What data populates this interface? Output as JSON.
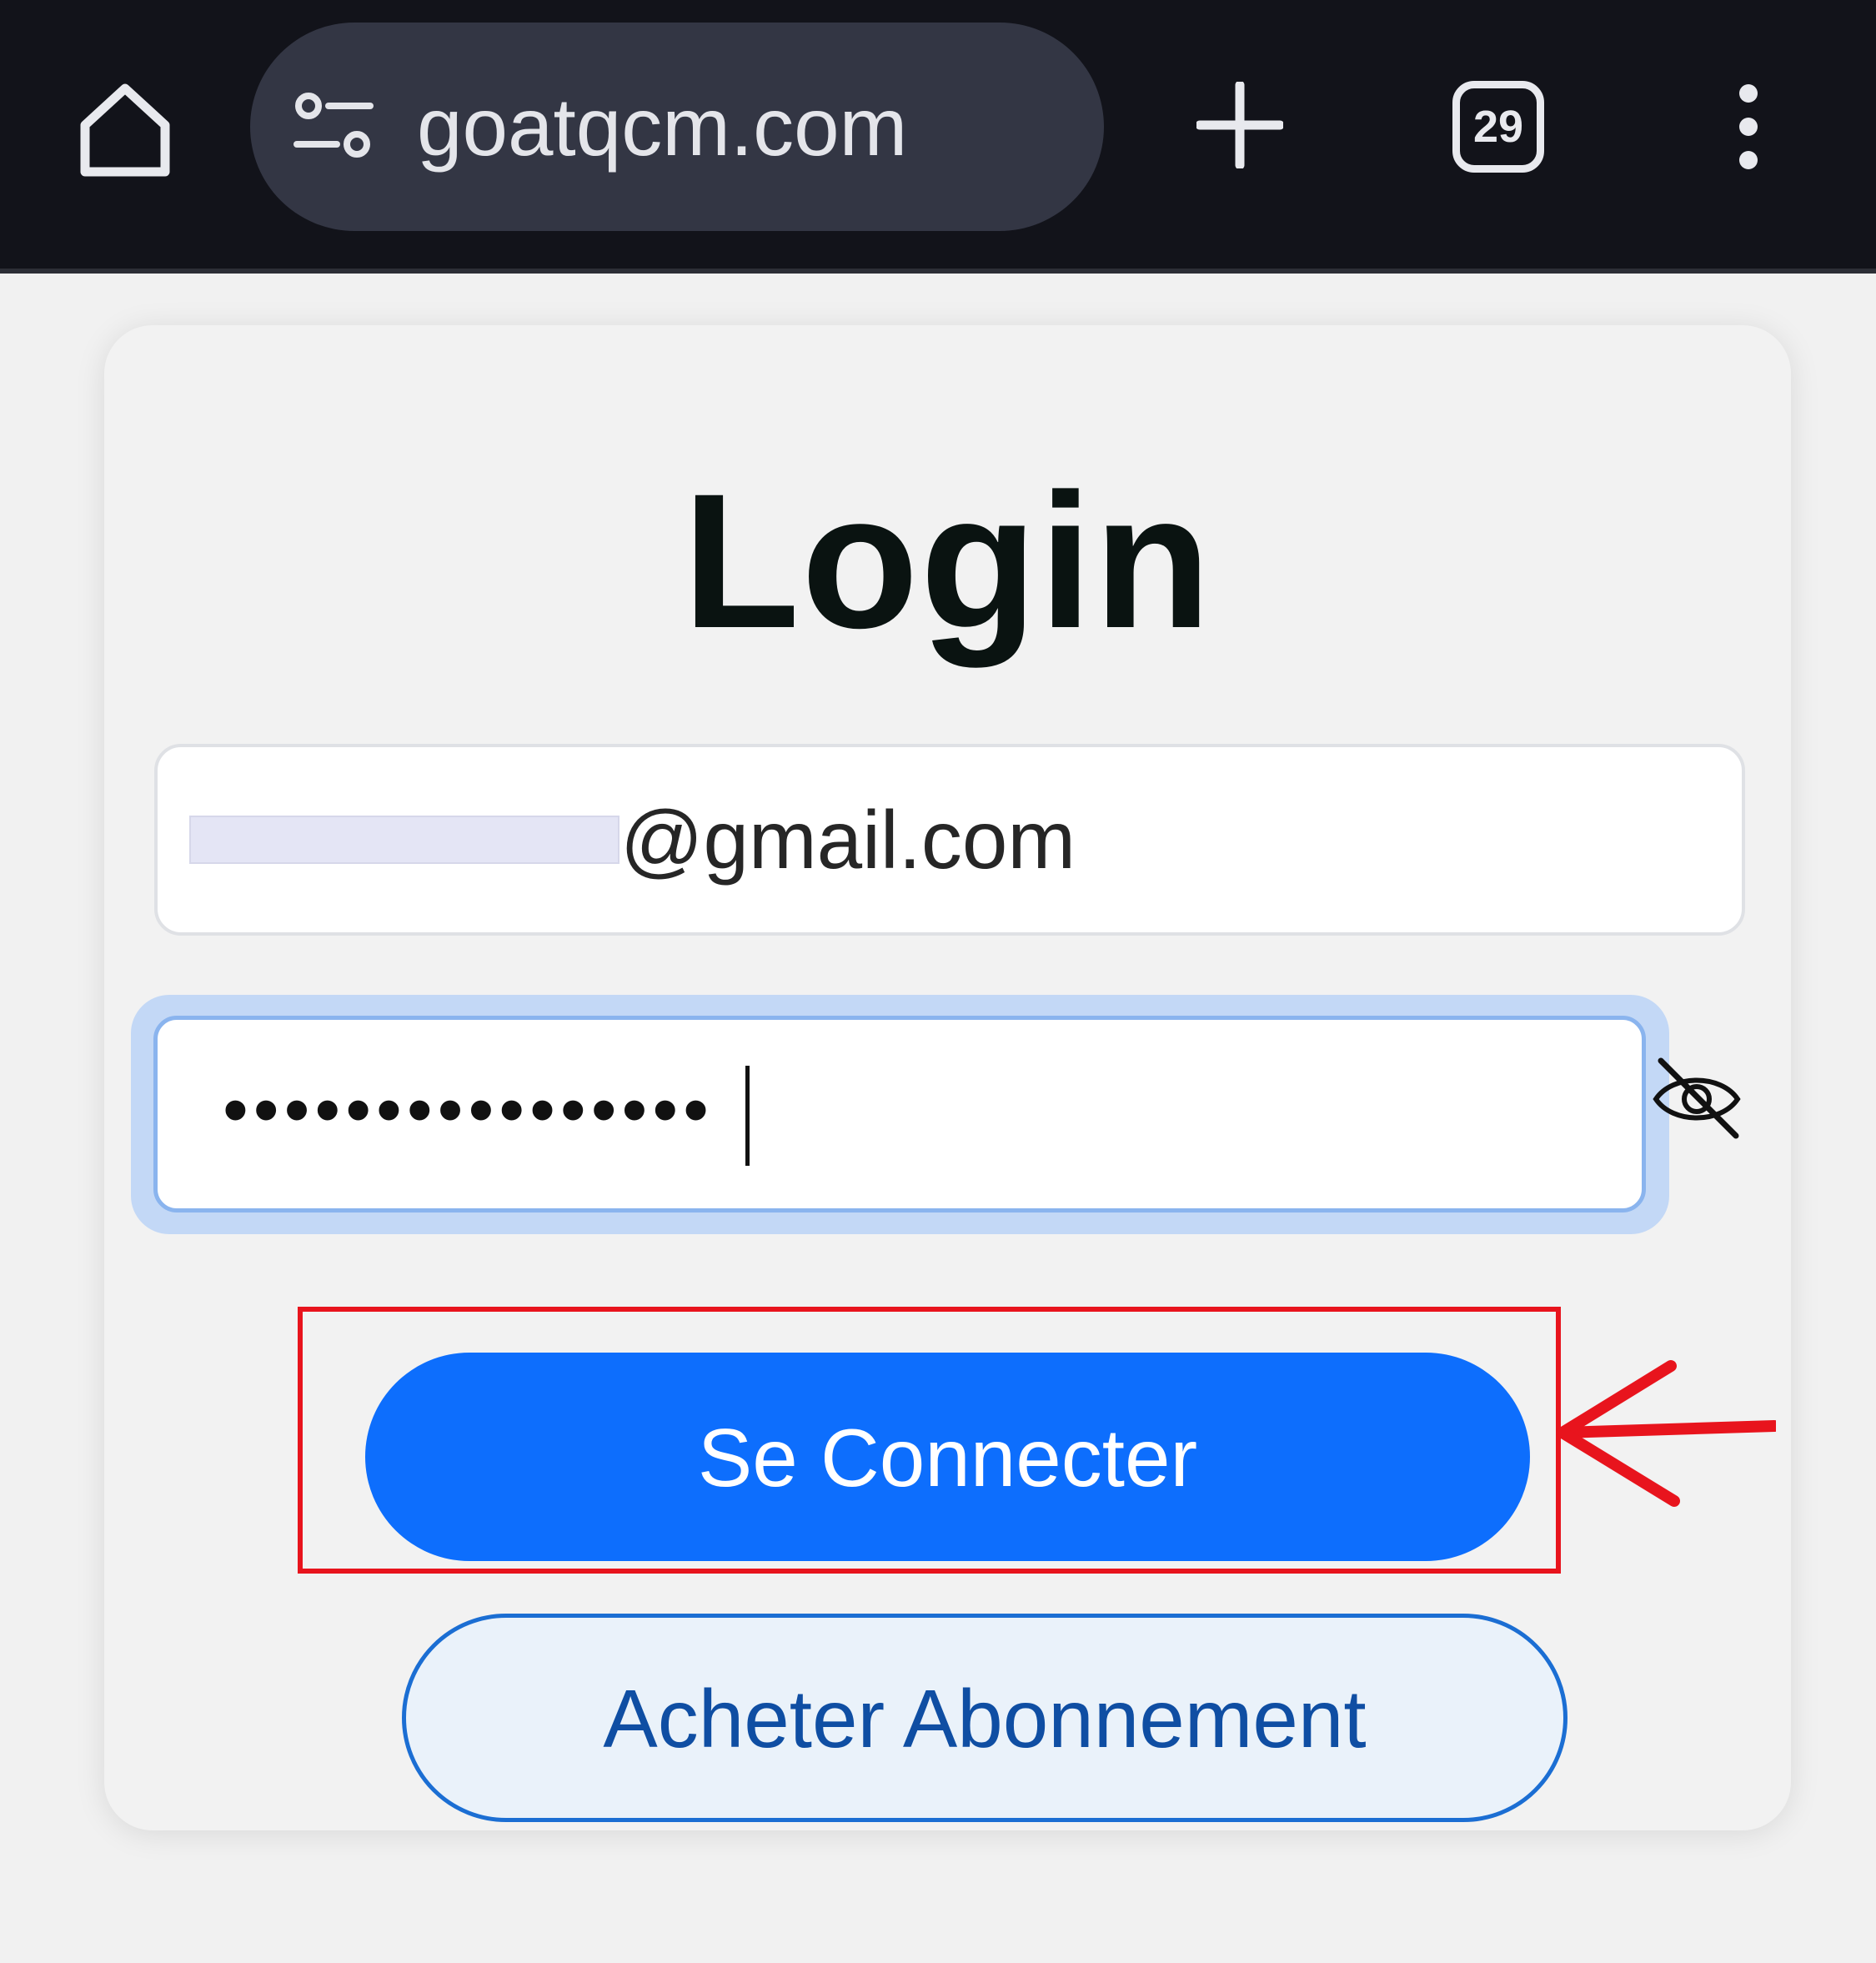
{
  "browser": {
    "url": "goatqcm.com",
    "tab_count": "29",
    "icons": [
      "home-icon",
      "site-settings-icon",
      "new-tab-icon",
      "tab-switcher-icon",
      "more-menu-icon"
    ]
  },
  "login": {
    "title": "Login",
    "email_value": "@gmail.com",
    "email_redacted": true,
    "password_value": "••••••••••••••••",
    "password_visibility_icon": "eye-slash-icon",
    "submit_label": "Se Connecter",
    "subscribe_label": "Acheter Abonnement"
  },
  "annotation": {
    "highlight_target": "submit-button",
    "color": "#e8141d"
  },
  "colors": {
    "toolbar_bg": "#12131a",
    "url_pill_bg": "#333644",
    "primary": "#0d6efd",
    "outline_text": "#0f4ea3",
    "focus_ring": "#c3d8f6"
  }
}
